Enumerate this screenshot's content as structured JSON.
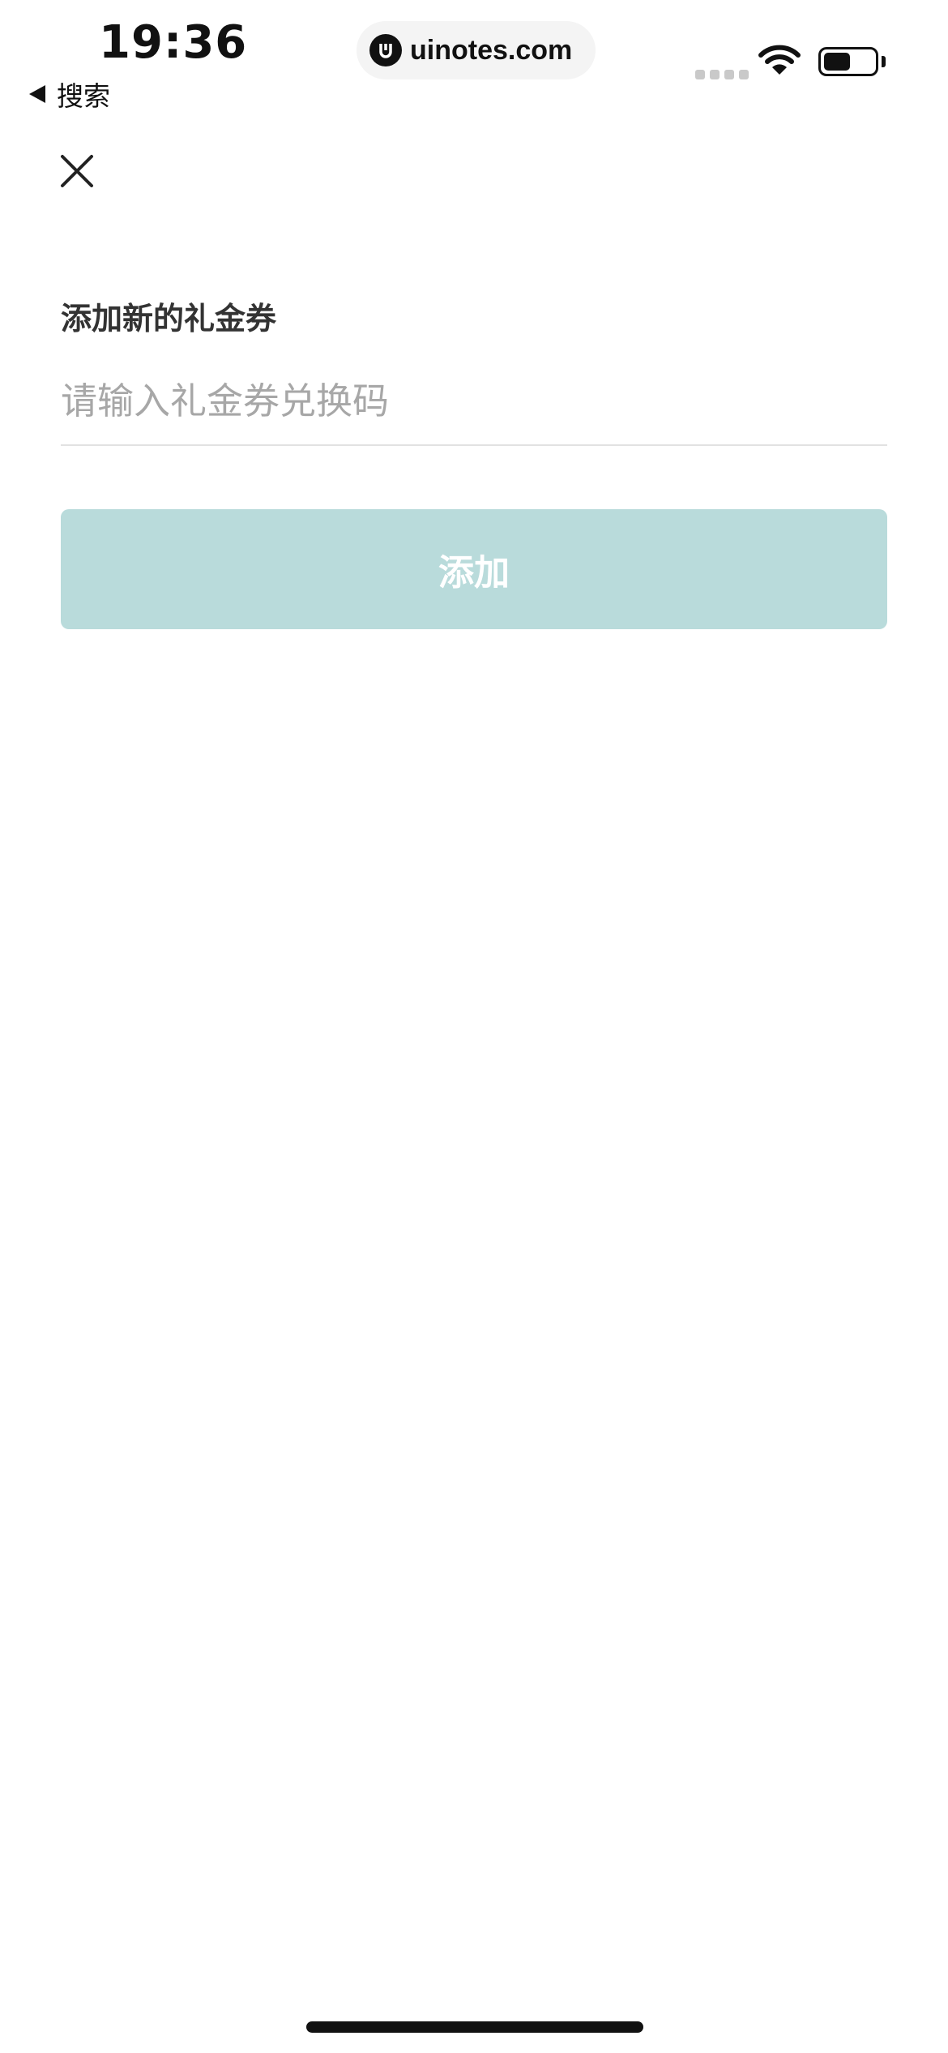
{
  "status_bar": {
    "time": "19:36",
    "back_label": "搜索",
    "url": "uinotes.com",
    "icons": [
      "signal-icon",
      "wifi-icon",
      "battery-icon"
    ]
  },
  "close_icon": "close-icon",
  "form": {
    "label": "添加新的礼金券",
    "input_value": "",
    "input_placeholder": "请输入礼金券兑换码",
    "submit_label": "添加"
  },
  "colors": {
    "button_bg": "#b9dbdb",
    "label_text": "#333333",
    "placeholder": "#a7a7a7",
    "divider": "#e2e2e2"
  }
}
